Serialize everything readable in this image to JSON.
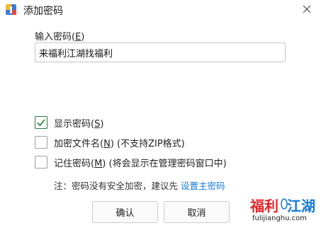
{
  "window": {
    "title": "添加密码"
  },
  "password": {
    "label": "输入密码(",
    "label_key": "E",
    "label_end": ")",
    "value": "来福利江湖找福利"
  },
  "options": [
    {
      "text": "显示密码(",
      "key": "S",
      "rest": ")",
      "checked": true
    },
    {
      "text": "加密文件名(",
      "key": "N",
      "rest": ") (不支持ZIP格式)",
      "checked": false
    },
    {
      "text": "记住密码(",
      "key": "M",
      "rest": ") (将会显示在管理密码窗口中)",
      "checked": false
    }
  ],
  "note": {
    "text": "注：密码没有安全加密，建议先 ",
    "link": "设置主密码"
  },
  "buttons": {
    "ok": "确认",
    "cancel": "取消"
  },
  "watermark": {
    "text": "福利江湖",
    "url": "fulijianghu.com"
  },
  "colors": {
    "accent": "#1479d6",
    "check": "#1f7a3a",
    "watermark_red": "#e0242a"
  }
}
